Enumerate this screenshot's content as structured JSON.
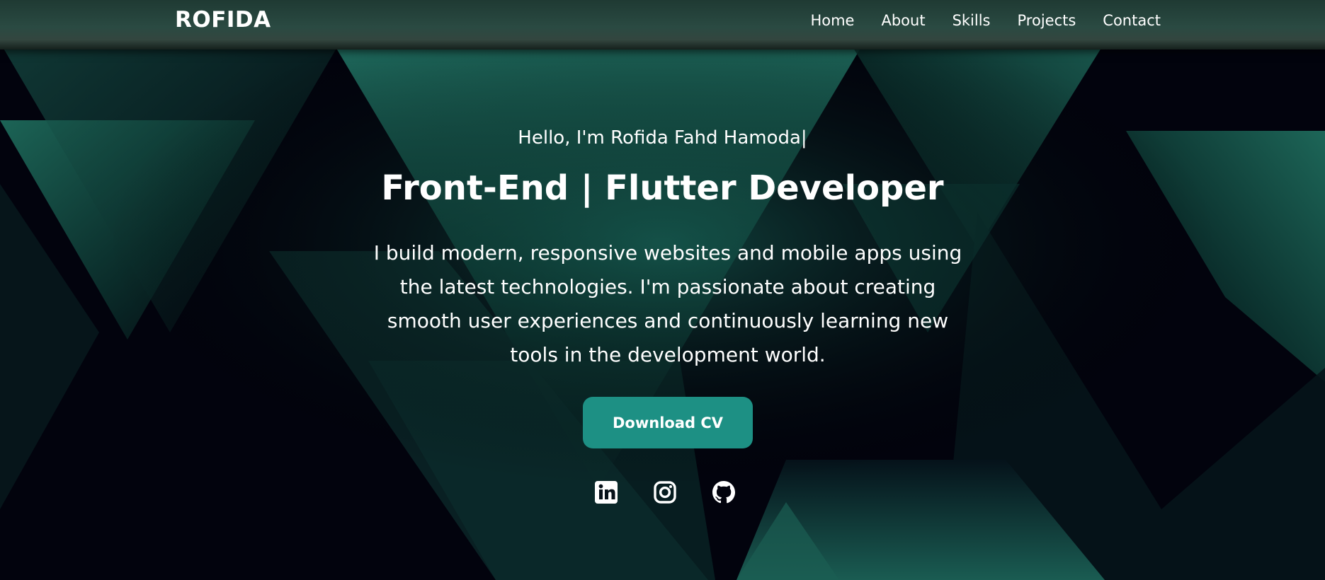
{
  "navbar": {
    "logo": "ROFIDA",
    "links": [
      {
        "label": "Home"
      },
      {
        "label": "About"
      },
      {
        "label": "Skills"
      },
      {
        "label": "Projects"
      },
      {
        "label": "Contact"
      }
    ]
  },
  "hero": {
    "greeting": "Hello, I'm Rofida Fahd Hamoda|",
    "headline": "Front-End | Flutter Developer",
    "description": "I build modern, responsive websites and mobile apps using the latest technologies. I'm passionate about creating smooth user experiences and continuously learning new tools in the development world.",
    "cta_label": "Download CV",
    "socials": [
      {
        "icon": "linkedin-icon"
      },
      {
        "icon": "instagram-icon"
      },
      {
        "icon": "github-icon"
      }
    ]
  },
  "colors": {
    "background": "#02030d",
    "accent": "#1d9084",
    "accent_glow": "#1e6b5e",
    "navbar": "#2a4a42",
    "text": "#ffffff"
  }
}
